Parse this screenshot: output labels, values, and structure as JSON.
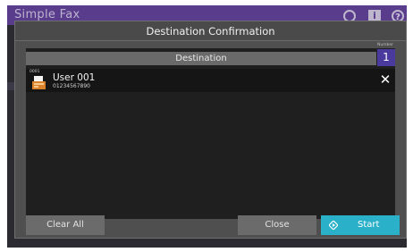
{
  "app": {
    "title": "Simple Fax",
    "header_icons": [
      "globe-icon",
      "info-icon",
      "help-icon"
    ]
  },
  "dialog": {
    "title": "Destination Confirmation",
    "column_header": "Destination",
    "number_caption": "Number",
    "number_value": "1",
    "entries": [
      {
        "index": "0001",
        "name": "User 001",
        "fax_number": "01234567890",
        "icon": "fax-icon",
        "remove_glyph": "✕"
      }
    ],
    "buttons": {
      "clear_all": "Clear All",
      "close": "Close",
      "start": "Start"
    }
  },
  "colors": {
    "header_purple": "#5a3c8c",
    "number_badge": "#4b3a9e",
    "start_button": "#2ab0c8",
    "dialog_bg": "#4f4f4f",
    "panel_bg": "#1f1f1f"
  }
}
